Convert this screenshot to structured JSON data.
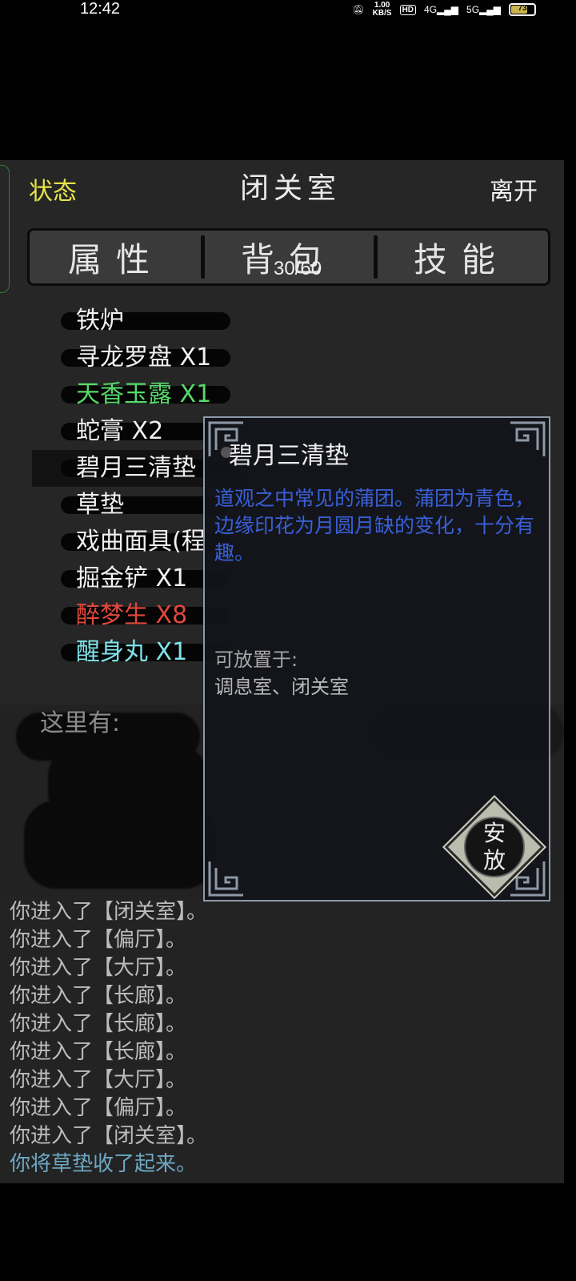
{
  "status_bar": {
    "time": "12:42",
    "net_speed_value": "1.00",
    "net_speed_unit": "KB/S",
    "hd_label": "HD",
    "signal_1_label": "4G",
    "signal_2_label": "5G",
    "battery_level": "73"
  },
  "header": {
    "status_label": "状态",
    "room_title": "闭关室",
    "leave_label": "离开"
  },
  "tabs": [
    {
      "label": "属性"
    },
    {
      "label": "背包"
    },
    {
      "label": "技能"
    }
  ],
  "inventory_count": "30/60",
  "items": [
    {
      "label": "铁炉",
      "color": "#f0f0f0"
    },
    {
      "label": "寻龙罗盘 X1",
      "color": "#f0f0f0"
    },
    {
      "label": "天香玉露 X1",
      "color": "#57d96a"
    },
    {
      "label": "蛇膏 X2",
      "color": "#f0f0f0"
    },
    {
      "label": "碧月三清垫",
      "color": "#f0f0f0",
      "selected": true
    },
    {
      "label": "草垫",
      "color": "#f0f0f0"
    },
    {
      "label": "戏曲面具(程",
      "color": "#f0f0f0"
    },
    {
      "label": "掘金铲 X1",
      "color": "#f0f0f0"
    },
    {
      "label": "醉梦生 X8",
      "color": "#e0483d"
    },
    {
      "label": "醒身丸 X1",
      "color": "#7fe3ea"
    }
  ],
  "here_label": "这里有:",
  "detail": {
    "name": "碧月三清垫",
    "description": "道观之中常见的蒲团。蒲团为青色，边缘印花为月圆月缺的变化，十分有趣。",
    "place_label": "可放置于:",
    "place_rooms": "调息室、闭关室",
    "action_label": "安放"
  },
  "log": [
    {
      "text": "你进入了【闭关室】。"
    },
    {
      "text": "你进入了【偏厅】。"
    },
    {
      "text": "你进入了【大厅】。"
    },
    {
      "text": "你进入了【长廊】。"
    },
    {
      "text": "你进入了【长廊】。"
    },
    {
      "text": "你进入了【长廊】。"
    },
    {
      "text": "你进入了【大厅】。"
    },
    {
      "text": "你进入了【偏厅】。"
    },
    {
      "text": "你进入了【闭关室】。"
    },
    {
      "text": "你将草垫收了起来。",
      "highlight": true
    }
  ],
  "colors": {
    "status_link": "#e8e44a",
    "description": "#3a5fd6",
    "log_highlight": "#6ea7c4"
  }
}
